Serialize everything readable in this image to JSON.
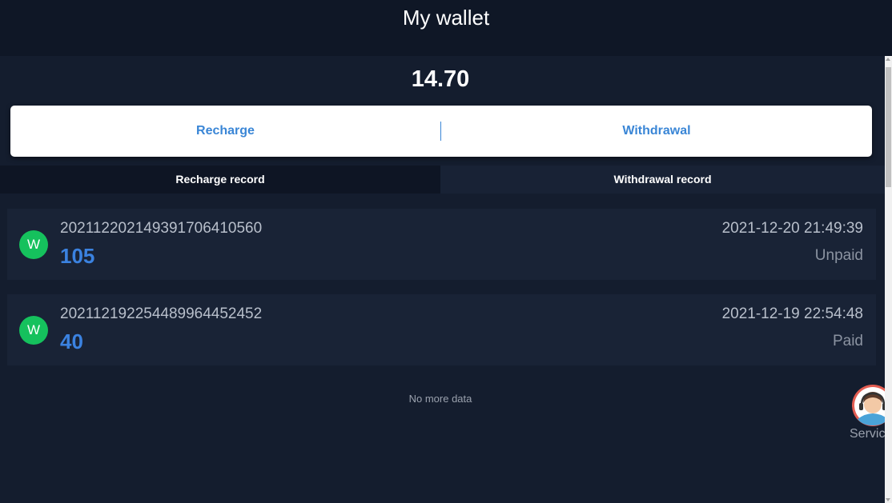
{
  "header": {
    "title": "My wallet"
  },
  "wallet": {
    "balance": "14.70"
  },
  "actions": {
    "recharge_label": "Recharge",
    "withdrawal_label": "Withdrawal"
  },
  "tabs": [
    {
      "label": "Recharge record",
      "active": false
    },
    {
      "label": "Withdrawal record",
      "active": true
    }
  ],
  "records": [
    {
      "badge": "W",
      "order_id": "20211220214939170641056O",
      "amount": "105",
      "time": "2021-12-20 21:49:39",
      "status": "Unpaid"
    },
    {
      "badge": "W",
      "order_id": "20211219225448996445245​2",
      "amount": "40",
      "time": "2021-12-19 22:54:48",
      "status": "Paid"
    }
  ],
  "list_footer": "No more data",
  "service": {
    "label": "Service",
    "icon": "customer-service-avatar-icon"
  },
  "colors": {
    "background": "#0f1726",
    "accent": "#3a86d6",
    "amount": "#3b82e0",
    "badge": "#15c15d"
  }
}
